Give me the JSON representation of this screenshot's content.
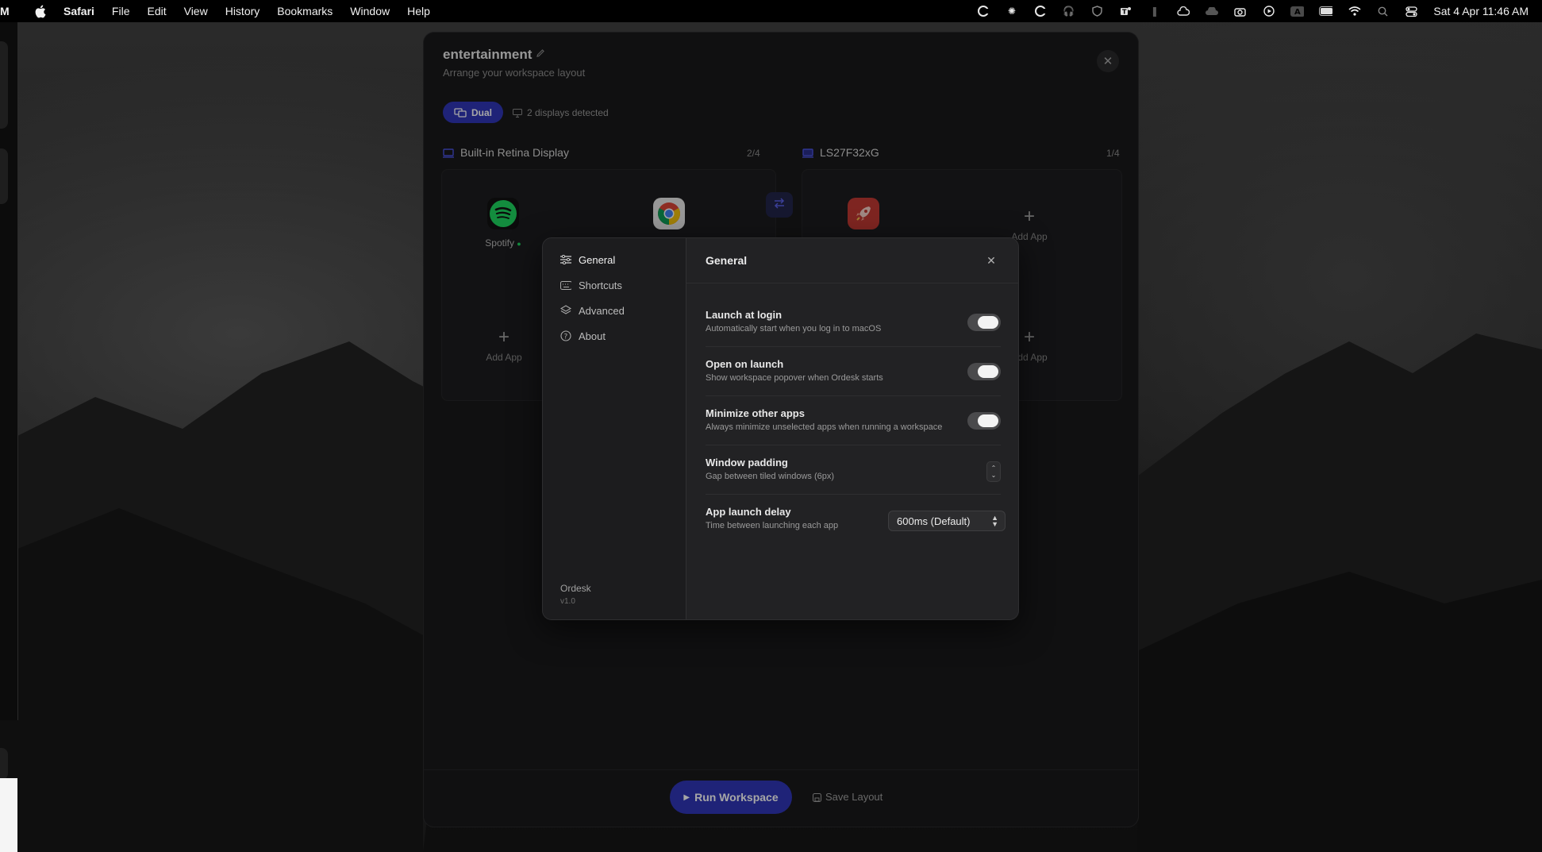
{
  "menubar": {
    "cut_text": "M",
    "app_name": "Safari",
    "items": [
      "File",
      "Edit",
      "View",
      "History",
      "Bookmarks",
      "Window",
      "Help"
    ],
    "datetime": "Sat 4 Apr  11:46 AM",
    "status_icons": [
      "app-c-icon",
      "sun-icon",
      "app-c2-icon",
      "headphones-icon",
      "shield-icon",
      "teams-icon",
      "figma-icon",
      "cloud-check-icon",
      "cloud-icon",
      "camera-icon",
      "play-icon",
      "input-a-icon",
      "battery-icon",
      "wifi-icon",
      "search-icon",
      "control-center-icon"
    ]
  },
  "workspace": {
    "title": "entertainment",
    "subtitle": "Arrange your workspace layout",
    "mode_label": "Dual",
    "detected_text": "2 displays detected",
    "display1": {
      "name": "Built-in Retina Display",
      "count": "2/4"
    },
    "display2": {
      "name": "LS27F32xG",
      "count": "1/4"
    },
    "apps": [
      {
        "name": "Spotify",
        "icon": "spotify-icon",
        "running": true
      },
      {
        "name": "",
        "icon": "chrome-icon"
      },
      {
        "name": "",
        "icon": "rocket-icon"
      }
    ],
    "add_app_label": "Add App",
    "run_button": "Run Workspace",
    "save_button": "Save Layout",
    "accent_color": "#3036b8"
  },
  "settings": {
    "nav": [
      {
        "label": "General",
        "icon": "sliders-icon",
        "active": true
      },
      {
        "label": "Shortcuts",
        "icon": "keyboard-icon"
      },
      {
        "label": "Advanced",
        "icon": "layers-icon"
      },
      {
        "label": "About",
        "icon": "question-icon"
      }
    ],
    "brand": "Ordesk",
    "version": "v1.0",
    "pane_title": "General",
    "rows": [
      {
        "title": "Launch at login",
        "desc": "Automatically start when you log in to macOS",
        "control": "toggle",
        "on": true
      },
      {
        "title": "Open on launch",
        "desc": "Show workspace popover when Ordesk starts",
        "control": "toggle",
        "on": true
      },
      {
        "title": "Minimize other apps",
        "desc": "Always minimize unselected apps when running a workspace",
        "control": "toggle",
        "on": true
      },
      {
        "title": "Window padding",
        "desc": "Gap between tiled windows (6px)",
        "control": "stepper"
      },
      {
        "title": "App launch delay",
        "desc": "Time between launching each app",
        "control": "select",
        "value": "600ms (Default)"
      }
    ]
  }
}
